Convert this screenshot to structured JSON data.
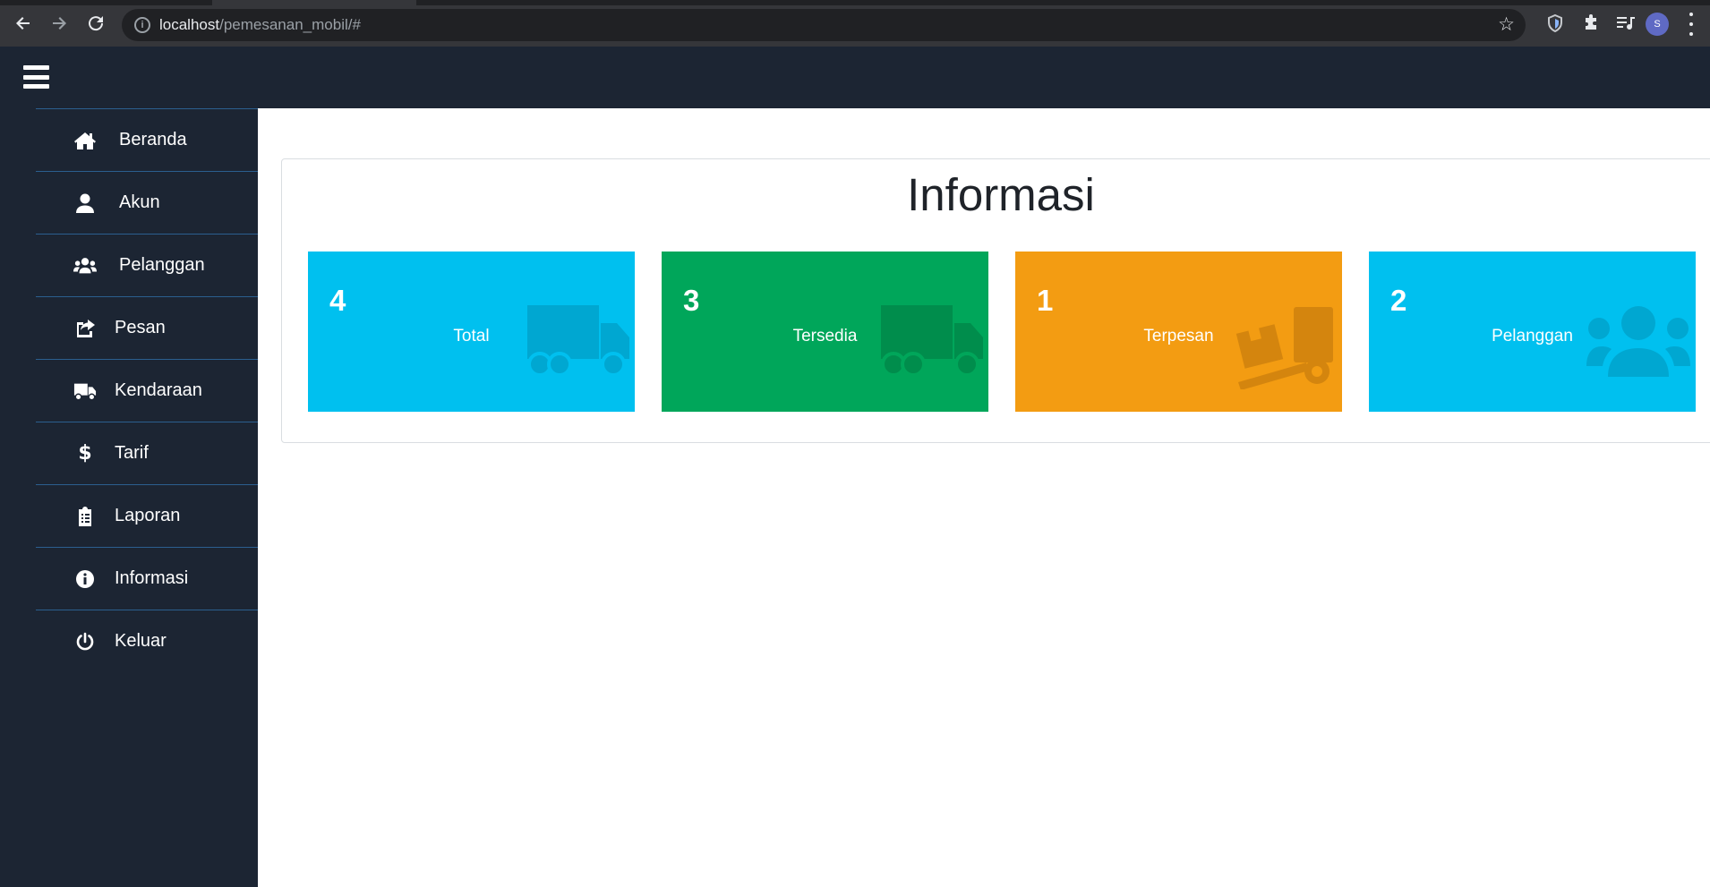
{
  "browser": {
    "url_host": "localhost",
    "url_path": "/pemesanan_mobil/#",
    "profile_initial": "S"
  },
  "sidebar": {
    "items": [
      {
        "label": "Beranda",
        "icon": "home-icon"
      },
      {
        "label": "Akun",
        "icon": "user-icon"
      },
      {
        "label": "Pelanggan",
        "icon": "users-icon"
      },
      {
        "label": "Pesan",
        "icon": "share-icon"
      },
      {
        "label": "Kendaraan",
        "icon": "truck-icon"
      },
      {
        "label": "Tarif",
        "icon": "dollar-icon"
      },
      {
        "label": "Laporan",
        "icon": "clipboard-icon"
      },
      {
        "label": "Informasi",
        "icon": "info-icon"
      },
      {
        "label": "Keluar",
        "icon": "power-icon"
      }
    ]
  },
  "main": {
    "title": "Informasi",
    "cards": [
      {
        "value": "4",
        "label": "Total",
        "color": "#00c0ef",
        "icon": "truck-icon"
      },
      {
        "value": "3",
        "label": "Tersedia",
        "color": "#00a65a",
        "icon": "truck-icon"
      },
      {
        "value": "1",
        "label": "Terpesan",
        "color": "#f39c12",
        "icon": "dolly-icon"
      },
      {
        "value": "2",
        "label": "Pelanggan",
        "color": "#00c0ef",
        "icon": "users-icon"
      }
    ]
  },
  "colors": {
    "header_bg": "#1c2533",
    "sidebar_border": "#2b5f8f"
  }
}
